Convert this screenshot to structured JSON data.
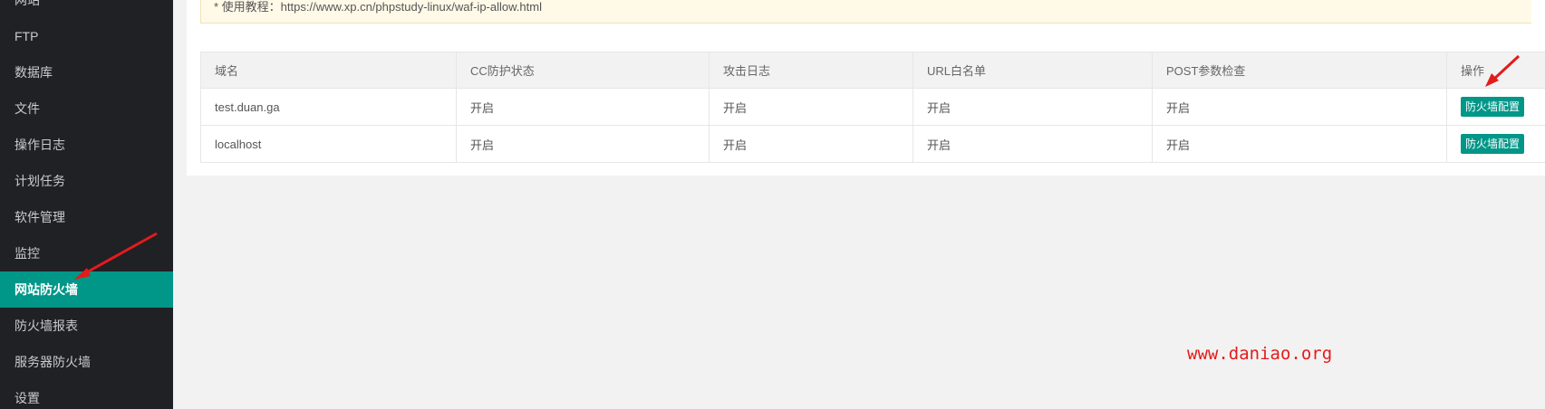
{
  "sidebar": {
    "items": [
      {
        "label": "网站"
      },
      {
        "label": "FTP"
      },
      {
        "label": "数据库"
      },
      {
        "label": "文件"
      },
      {
        "label": "操作日志"
      },
      {
        "label": "计划任务"
      },
      {
        "label": "软件管理"
      },
      {
        "label": "监控"
      },
      {
        "label": "网站防火墙"
      },
      {
        "label": "防火墙报表"
      },
      {
        "label": "服务器防火墙"
      },
      {
        "label": "设置"
      }
    ],
    "active_label": "网站防火墙"
  },
  "tip": {
    "text": "* 使用教程：https://www.xp.cn/phpstudy-linux/waf-ip-allow.html"
  },
  "table": {
    "headers": [
      "域名",
      "CC防护状态",
      "攻击日志",
      "URL白名单",
      "POST参数检查",
      "操作"
    ],
    "rows": [
      {
        "domain": "test.duan.ga",
        "cc": "开启",
        "attack_log": "开启",
        "url_whitelist": "开启",
        "post_check": "开启",
        "action": "防火墙配置"
      },
      {
        "domain": "localhost",
        "cc": "开启",
        "attack_log": "开启",
        "url_whitelist": "开启",
        "post_check": "开启",
        "action": "防火墙配置"
      }
    ]
  },
  "watermark": "www.daniao.org",
  "colors": {
    "sidebar_bg": "#1f2125",
    "accent": "#009688",
    "annotation_red": "#e31b1b"
  }
}
